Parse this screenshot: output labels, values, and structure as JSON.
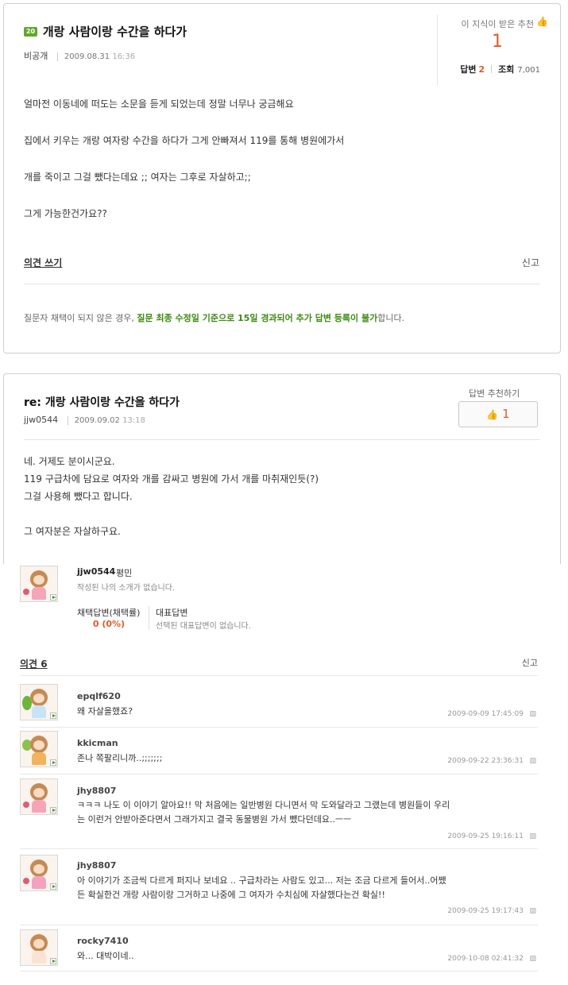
{
  "question": {
    "level_badge": "20",
    "title": "개랑 사람이랑 수간을 하다가",
    "author": "비공개",
    "date": "2009.08.31",
    "time": "16:36",
    "recommend_label": "이 지식이 받은 추천",
    "recommend_count": "1",
    "answers_label": "답변",
    "answers_count": "2",
    "views_label": "조회",
    "views_count": "7,001",
    "body": [
      "얼마전 이동네에 떠도는 소문을 듣게 되었는데 정말 너무나 궁금해요",
      "집에서 키우는 개랑 여자랑 수간을 하다가 그게 안빠져서 119를 통해 병원에가서",
      "개를 죽이고 그걸 뺐다는데요 ;; 여자는 그후로 자살하고;;",
      "그게 가능한건가요??"
    ],
    "opinion_link": "의견 쓰기",
    "report": "신고",
    "notice_pre": "질문자 채택이 되지 않은 경우, ",
    "notice_highlight": "질문 최종 수정일 기준으로 15일 경과되어 추가 답변 등록이 불가",
    "notice_post": "합니다."
  },
  "answer": {
    "title": "re: 개랑 사람이랑 수간을 하다가",
    "author": "jjw0544",
    "date": "2009.09.02",
    "time": "13:18",
    "recommend_label": "답변 추천하기",
    "recommend_count": "1",
    "body": [
      "네. 거제도 분이시군요.",
      "119 구급차에 담요로 여자와 개를 감싸고 병원에 가서 개를 마취재인듯(?)",
      "그걸 사용해 뺐다고 합니다.",
      "",
      "그 여자분은 자살하구요."
    ]
  },
  "profile": {
    "name": "jjw0544",
    "rank": "평민",
    "intro": "작성된 나의 소개가 없습니다.",
    "selected_label": "채택답변(채택률)",
    "selected_value": "0 (0%)",
    "rep_label": "대표답변",
    "rep_value": "선택된 대표답변이 없습니다."
  },
  "comments_section": {
    "header": "의견 6",
    "report": "신고",
    "items": [
      {
        "user": "epqlf620",
        "text": "왜 자살을했죠?",
        "date": "2009-09-09 17:45:09"
      },
      {
        "user": "kkicman",
        "text": "존나 쪽팔리니까..;;;;;;;",
        "date": "2009-09-22 23:36:31"
      },
      {
        "user": "jhy8807",
        "text": "ㅋㅋㅋ 나도 이 이야기 알아요!! 막 처음에는 일반병원 다니면서 막 도와달라고 그랬는데 병원들이 우리는 이런거 안받아준다면서 그래가지고 결국 동물병원 가서 뺐다던데요..ㅡㅡ",
        "date": "2009-09-25 19:16:11"
      },
      {
        "user": "jhy8807",
        "text": "아 이야기가 조금씩 다르게 퍼지나 보네요 .. 구급차라는 사람도 있고... 저는 조금 다르게 들어서..어쨌든 확실한건 개랑 사람이랑 그거하고 나중에 그 여자가 수치심에 자살했다는건 확실!!",
        "date": "2009-09-25 19:17:43"
      },
      {
        "user": "rocky7410",
        "text": "와... 대박이네..",
        "date": "2009-10-08 02:41:32"
      }
    ]
  },
  "icons": {
    "thumb": "thumbs-up-icon",
    "lock": "lock-icon",
    "avatar": "monkey-avatar-icon"
  },
  "colors": {
    "accent_orange": "#e05a2b",
    "notice_green": "#3d8a14",
    "badge_green": "#5fa82a"
  }
}
